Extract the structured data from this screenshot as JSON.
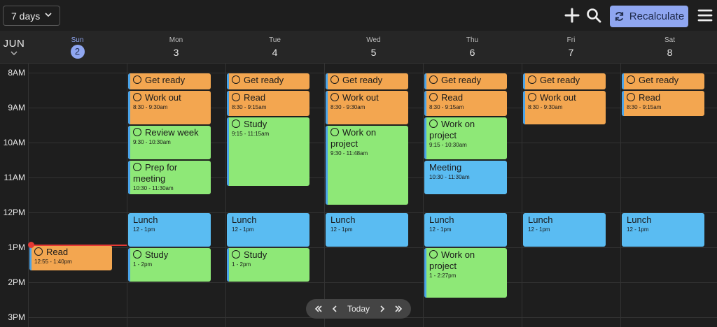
{
  "toolbar": {
    "view_label": "7 days",
    "add_icon": "plus-icon",
    "search_icon": "search-icon",
    "recalculate_label": "Recalculate",
    "menu_icon": "hamburger-menu-icon"
  },
  "header": {
    "month": "JUN",
    "days": [
      {
        "name": "Sun",
        "num": "2",
        "today": true
      },
      {
        "name": "Mon",
        "num": "3"
      },
      {
        "name": "Tue",
        "num": "4"
      },
      {
        "name": "Wed",
        "num": "5"
      },
      {
        "name": "Thu",
        "num": "6"
      },
      {
        "name": "Fri",
        "num": "7"
      },
      {
        "name": "Sat",
        "num": "8"
      }
    ]
  },
  "hours": [
    "8AM",
    "9AM",
    "10AM",
    "11AM",
    "12PM",
    "1PM",
    "2PM",
    "3PM"
  ],
  "events": [
    {
      "day": 0,
      "start": 12.92,
      "end": 13.67,
      "title": "Read",
      "time": "12:55 - 1:40pm",
      "color": "orange",
      "task": true
    },
    {
      "day": 1,
      "start": 8.0,
      "end": 8.5,
      "title": "Get ready",
      "time": "",
      "color": "orange",
      "task": true
    },
    {
      "day": 1,
      "start": 8.5,
      "end": 9.5,
      "title": "Work out",
      "time": "8:30 - 9:30am",
      "color": "orange",
      "task": true
    },
    {
      "day": 1,
      "start": 9.5,
      "end": 10.5,
      "title": "Review week",
      "time": "9:30 - 10:30am",
      "color": "green",
      "task": true
    },
    {
      "day": 1,
      "start": 10.5,
      "end": 11.5,
      "title": "Prep for meeting",
      "time": "10:30 - 11:30am",
      "color": "green",
      "task": true
    },
    {
      "day": 1,
      "start": 12.0,
      "end": 13.0,
      "title": "Lunch",
      "time": "12 - 1pm",
      "color": "blue",
      "task": false
    },
    {
      "day": 1,
      "start": 13.0,
      "end": 14.0,
      "title": "Study",
      "time": "1 - 2pm",
      "color": "green",
      "task": true
    },
    {
      "day": 2,
      "start": 8.0,
      "end": 8.5,
      "title": "Get ready",
      "time": "",
      "color": "orange",
      "task": true
    },
    {
      "day": 2,
      "start": 8.5,
      "end": 9.25,
      "title": "Read",
      "time": "8:30 - 9:15am",
      "color": "orange",
      "task": true
    },
    {
      "day": 2,
      "start": 9.25,
      "end": 11.25,
      "title": "Study",
      "time": "9:15 - 11:15am",
      "color": "green",
      "task": true
    },
    {
      "day": 2,
      "start": 12.0,
      "end": 13.0,
      "title": "Lunch",
      "time": "12 - 1pm",
      "color": "blue",
      "task": false
    },
    {
      "day": 2,
      "start": 13.0,
      "end": 14.0,
      "title": "Study",
      "time": "1 - 2pm",
      "color": "green",
      "task": true
    },
    {
      "day": 3,
      "start": 8.0,
      "end": 8.5,
      "title": "Get ready",
      "time": "",
      "color": "orange",
      "task": true
    },
    {
      "day": 3,
      "start": 8.5,
      "end": 9.5,
      "title": "Work out",
      "time": "8:30 - 9:30am",
      "color": "orange",
      "task": true
    },
    {
      "day": 3,
      "start": 9.5,
      "end": 11.8,
      "title": "Work on project",
      "time": "9:30 - 11:48am",
      "color": "green",
      "task": true
    },
    {
      "day": 3,
      "start": 12.0,
      "end": 13.0,
      "title": "Lunch",
      "time": "12 - 1pm",
      "color": "blue",
      "task": false
    },
    {
      "day": 4,
      "start": 8.0,
      "end": 8.5,
      "title": "Get ready",
      "time": "",
      "color": "orange",
      "task": true
    },
    {
      "day": 4,
      "start": 8.5,
      "end": 9.25,
      "title": "Read",
      "time": "8:30 - 9:15am",
      "color": "orange",
      "task": true
    },
    {
      "day": 4,
      "start": 9.25,
      "end": 10.5,
      "title": "Work on project",
      "time": "9:15 - 10:30am",
      "color": "green",
      "task": true
    },
    {
      "day": 4,
      "start": 10.5,
      "end": 11.5,
      "title": "Meeting",
      "time": "10:30 - 11:30am",
      "color": "blue",
      "task": false
    },
    {
      "day": 4,
      "start": 12.0,
      "end": 13.0,
      "title": "Lunch",
      "time": "12 - 1pm",
      "color": "blue",
      "task": false
    },
    {
      "day": 4,
      "start": 13.0,
      "end": 14.45,
      "title": "Work on project",
      "time": "1 - 2:27pm",
      "color": "green",
      "task": true
    },
    {
      "day": 5,
      "start": 8.0,
      "end": 8.5,
      "title": "Get ready",
      "time": "",
      "color": "orange",
      "task": true
    },
    {
      "day": 5,
      "start": 8.5,
      "end": 9.5,
      "title": "Work out",
      "time": "8:30 - 9:30am",
      "color": "orange",
      "task": true
    },
    {
      "day": 5,
      "start": 12.0,
      "end": 13.0,
      "title": "Lunch",
      "time": "12 - 1pm",
      "color": "blue",
      "task": false
    },
    {
      "day": 6,
      "start": 8.0,
      "end": 8.5,
      "title": "Get ready",
      "time": "",
      "color": "orange",
      "task": true
    },
    {
      "day": 6,
      "start": 8.5,
      "end": 9.25,
      "title": "Read",
      "time": "8:30 - 9:15am",
      "color": "orange",
      "task": true
    },
    {
      "day": 6,
      "start": 12.0,
      "end": 13.0,
      "title": "Lunch",
      "time": "12 - 1pm",
      "color": "blue",
      "task": false
    }
  ],
  "nav": {
    "today_label": "Today",
    "first_icon": "double-chevron-left-icon",
    "prev_icon": "chevron-left-icon",
    "next_icon": "chevron-right-icon",
    "last_icon": "double-chevron-right-icon"
  },
  "colors": {
    "accent": "#8fa6f0",
    "orange": "#f3a650",
    "green": "#8ee877",
    "blue": "#5abcf2",
    "now": "#e53935"
  }
}
